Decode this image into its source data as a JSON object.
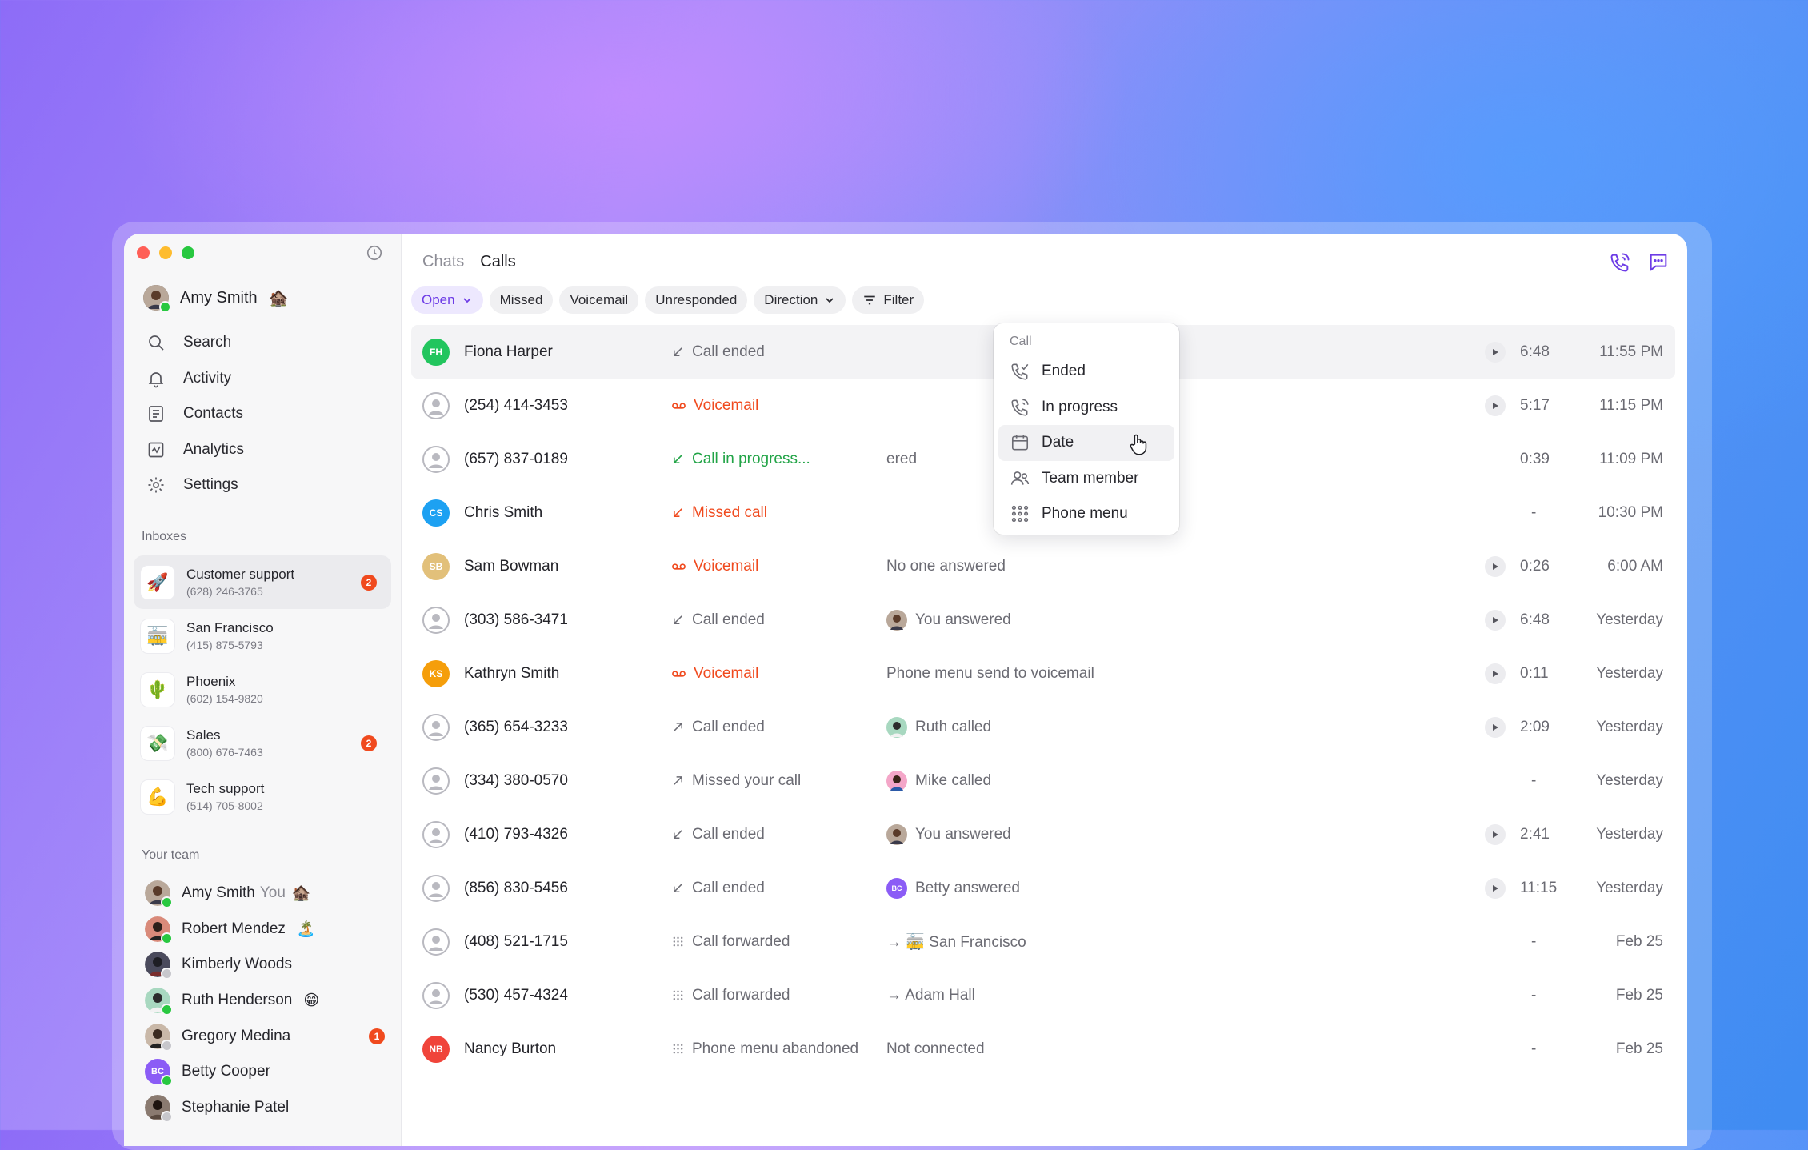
{
  "sidebar": {
    "user": {
      "name": "Amy Smith",
      "emoji": "🏚️"
    },
    "nav": [
      {
        "label": "Search",
        "icon": "search-icon"
      },
      {
        "label": "Activity",
        "icon": "bell-icon"
      },
      {
        "label": "Contacts",
        "icon": "contacts-icon"
      },
      {
        "label": "Analytics",
        "icon": "analytics-icon"
      },
      {
        "label": "Settings",
        "icon": "gear-icon"
      }
    ],
    "inboxes_label": "Inboxes",
    "inboxes": [
      {
        "name": "Customer support",
        "phone": "(628) 246-3765",
        "emoji": "🚀",
        "badge": "2"
      },
      {
        "name": "San Francisco",
        "phone": "(415) 875-5793",
        "emoji": "🚋",
        "badge": ""
      },
      {
        "name": "Phoenix",
        "phone": "(602) 154-9820",
        "emoji": "🌵",
        "badge": ""
      },
      {
        "name": "Sales",
        "phone": "(800) 676-7463",
        "emoji": "💸",
        "badge": "2"
      },
      {
        "name": "Tech support",
        "phone": "(514) 705-8002",
        "emoji": "💪",
        "badge": ""
      }
    ],
    "team_label": "Your team",
    "team": [
      {
        "name": "Amy Smith",
        "you": "You",
        "emoji": "🏚️",
        "badge": ""
      },
      {
        "name": "Robert Mendez",
        "you": "",
        "emoji": "🏝️",
        "badge": ""
      },
      {
        "name": "Kimberly Woods",
        "you": "",
        "emoji": "",
        "badge": ""
      },
      {
        "name": "Ruth Henderson",
        "you": "",
        "emoji": "😁",
        "badge": ""
      },
      {
        "name": "Gregory Medina",
        "you": "",
        "emoji": "",
        "badge": "1"
      },
      {
        "name": "Betty Cooper",
        "you": "",
        "emoji": "",
        "badge": "",
        "initials": "BC"
      },
      {
        "name": "Stephanie Patel",
        "you": "",
        "emoji": "",
        "badge": ""
      }
    ]
  },
  "tabs": [
    "Chats",
    "Calls"
  ],
  "filters": [
    {
      "label": "Open",
      "dropdown": true
    },
    {
      "label": "Missed"
    },
    {
      "label": "Voicemail"
    },
    {
      "label": "Unresponded"
    },
    {
      "label": "Direction",
      "dropdown": true
    },
    {
      "label": "Filter",
      "icon": "filter-icon"
    }
  ],
  "calls": [
    {
      "name": "Fiona Harper",
      "initials": "FH",
      "status": "Call ended",
      "status_kind": "ended-in",
      "detail": "",
      "duration": "6:48",
      "time": "11:55 PM",
      "play": true
    },
    {
      "name": "(254) 414-3453",
      "status": "Voicemail",
      "status_kind": "voicemail",
      "detail": "",
      "duration": "5:17",
      "time": "11:15 PM",
      "play": true
    },
    {
      "name": "(657) 837-0189",
      "status": "Call in progress...",
      "status_kind": "progress",
      "detail": "ered",
      "duration": "0:39",
      "time": "11:09 PM",
      "play": false
    },
    {
      "name": "Chris Smith",
      "initials": "CS",
      "status": "Missed call",
      "status_kind": "missed",
      "detail": "",
      "duration": "-",
      "time": "10:30 PM",
      "play": false
    },
    {
      "name": "Sam Bowman",
      "initials": "SB",
      "status": "Voicemail",
      "status_kind": "voicemail",
      "detail": "No one answered",
      "duration": "0:26",
      "time": "6:00 AM",
      "play": true
    },
    {
      "name": "(303) 586-3471",
      "status": "Call ended",
      "status_kind": "ended-in",
      "detail": "You answered",
      "detail_avatar": "amy",
      "duration": "6:48",
      "time": "Yesterday",
      "play": true
    },
    {
      "name": "Kathryn Smith",
      "initials": "KS",
      "status": "Voicemail",
      "status_kind": "voicemail",
      "detail": "Phone menu send to voicemail",
      "duration": "0:11",
      "time": "Yesterday",
      "play": true
    },
    {
      "name": "(365) 654-3233",
      "status": "Call ended",
      "status_kind": "ended-out",
      "detail": "Ruth called",
      "detail_avatar": "ruth",
      "duration": "2:09",
      "time": "Yesterday",
      "play": true
    },
    {
      "name": "(334) 380-0570",
      "status": "Missed your call",
      "status_kind": "ended-out",
      "detail": "Mike called",
      "detail_avatar": "mike",
      "duration": "-",
      "time": "Yesterday",
      "play": false
    },
    {
      "name": "(410) 793-4326",
      "status": "Call ended",
      "status_kind": "ended-in",
      "detail": "You answered",
      "detail_avatar": "amy",
      "duration": "2:41",
      "time": "Yesterday",
      "play": true
    },
    {
      "name": "(856) 830-5456",
      "status": "Call ended",
      "status_kind": "ended-in",
      "detail": "Betty answered",
      "detail_avatar": "BC",
      "duration": "11:15",
      "time": "Yesterday",
      "play": true
    },
    {
      "name": "(408) 521-1715",
      "status": "Call forwarded",
      "status_kind": "menu",
      "detail": "→ 🚋 San Francisco",
      "duration": "-",
      "time": "Feb 25",
      "play": false
    },
    {
      "name": "(530) 457-4324",
      "status": "Call forwarded",
      "status_kind": "menu",
      "detail": "→ Adam Hall",
      "duration": "-",
      "time": "Feb 25",
      "play": false
    },
    {
      "name": "Nancy Burton",
      "initials": "NB",
      "status": "Phone menu abandoned",
      "status_kind": "menu",
      "detail": "Not connected",
      "duration": "-",
      "time": "Feb 25",
      "play": false
    }
  ],
  "dropdown": {
    "header": "Call",
    "items": [
      {
        "label": "Ended",
        "icon": "phone-check-icon"
      },
      {
        "label": "In progress",
        "icon": "phone-ringing-icon"
      },
      {
        "label": "Date",
        "icon": "calendar-icon"
      },
      {
        "label": "Team member",
        "icon": "team-icon"
      },
      {
        "label": "Phone menu",
        "icon": "keypad-icon"
      }
    ]
  },
  "colors": {
    "accent": "#6d3ce6",
    "missed": "#f04a1e",
    "progress": "#22a447",
    "badge": "#f04a1e"
  }
}
